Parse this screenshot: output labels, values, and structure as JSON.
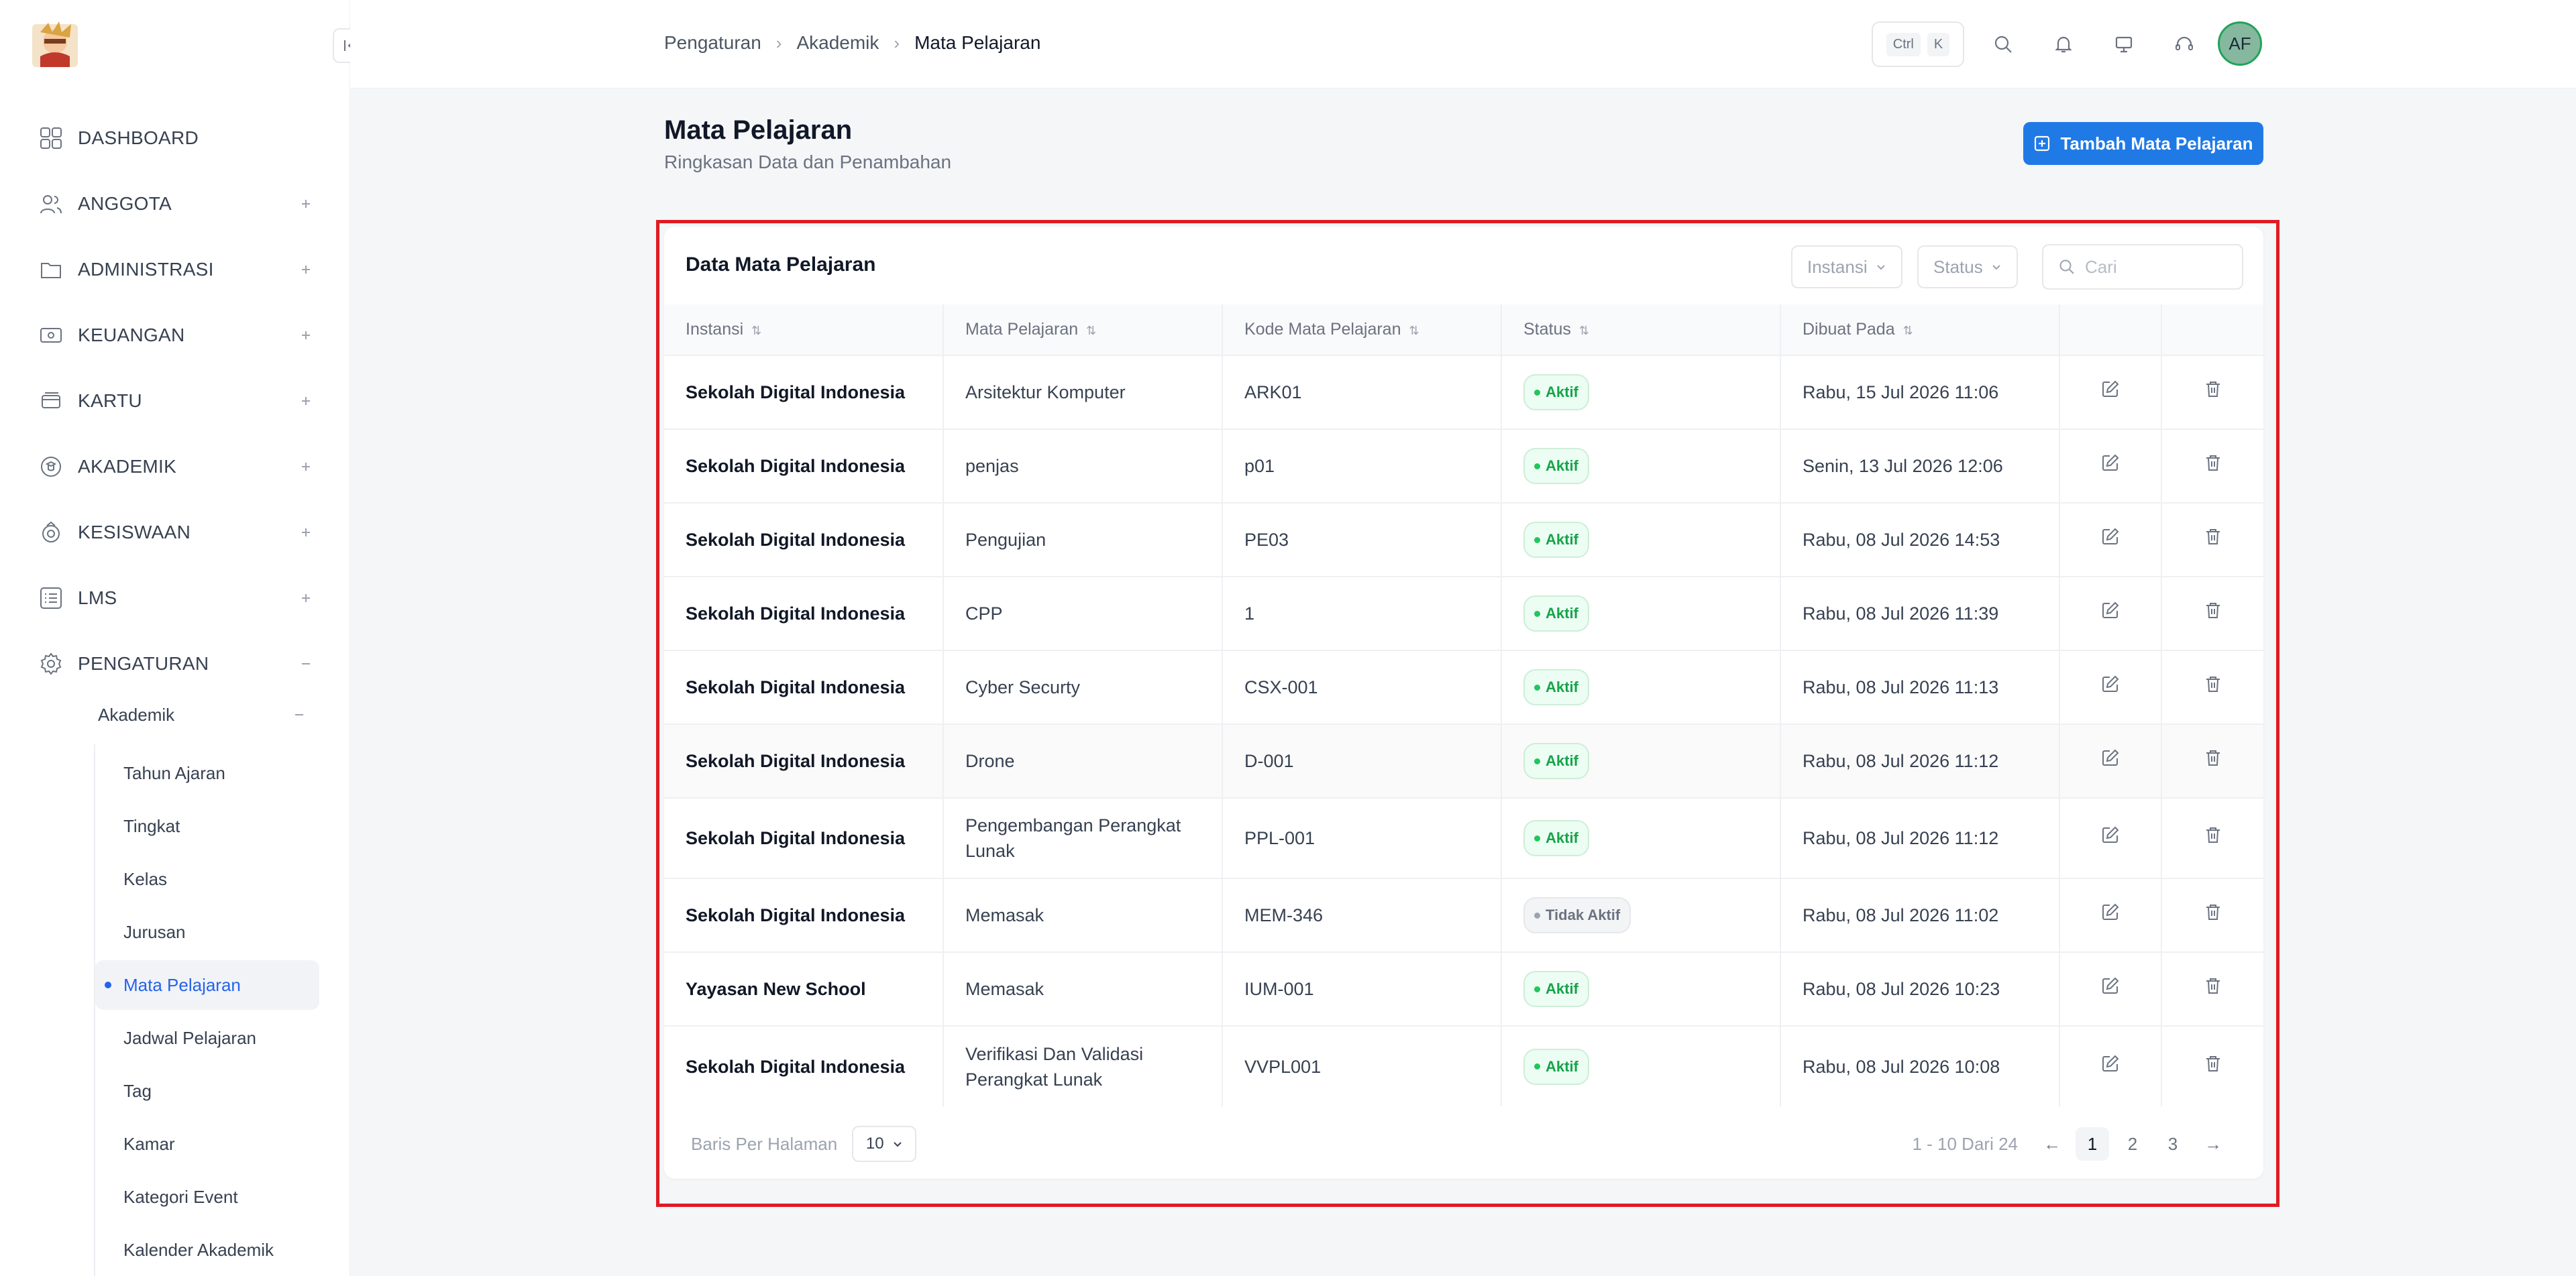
{
  "sidebar": {
    "items": [
      {
        "label": "DASHBOARD",
        "icon": "grid-icon",
        "toggle": ""
      },
      {
        "label": "ANGGOTA",
        "icon": "users-icon",
        "toggle": "+"
      },
      {
        "label": "ADMINISTRASI",
        "icon": "folder-icon",
        "toggle": "+"
      },
      {
        "label": "KEUANGAN",
        "icon": "money-icon",
        "toggle": "+"
      },
      {
        "label": "KARTU",
        "icon": "cards-icon",
        "toggle": "+"
      },
      {
        "label": "AKADEMIK",
        "icon": "academic-icon",
        "toggle": "+"
      },
      {
        "label": "KESISWAAN",
        "icon": "student-icon",
        "toggle": "+"
      },
      {
        "label": "LMS",
        "icon": "list-icon",
        "toggle": "+"
      },
      {
        "label": "PENGATURAN",
        "icon": "gear-icon",
        "toggle": "−"
      }
    ],
    "sub_group": {
      "label": "Akademik",
      "toggle": "−"
    },
    "leaves": [
      "Tahun Ajaran",
      "Tingkat",
      "Kelas",
      "Jurusan",
      "Mata Pelajaran",
      "Jadwal Pelajaran",
      "Tag",
      "Kamar",
      "Kategori Event",
      "Kalender Akademik"
    ],
    "active_leaf": "Mata Pelajaran"
  },
  "header": {
    "breadcrumb": [
      "Pengaturan",
      "Akademik",
      "Mata Pelajaran"
    ],
    "shortcut": {
      "key1": "Ctrl",
      "key2": "K"
    },
    "avatar_initials": "AF"
  },
  "page": {
    "title": "Mata Pelajaran",
    "subtitle": "Ringkasan Data dan Penambahan",
    "add_button": "Tambah Mata Pelajaran"
  },
  "card": {
    "title": "Data Mata Pelajaran",
    "filter_instansi": "Instansi",
    "filter_status": "Status",
    "search_placeholder": "Cari"
  },
  "table": {
    "columns": [
      "Instansi",
      "Mata Pelajaran",
      "Kode Mata Pelajaran",
      "Status",
      "Dibuat Pada"
    ],
    "rows": [
      {
        "instansi": "Sekolah Digital Indonesia",
        "mapel": "Arsitektur Komputer",
        "kode": "ARK01",
        "status": "Aktif",
        "dibuat": "Rabu, 15 Jul 2026 11:06"
      },
      {
        "instansi": "Sekolah Digital Indonesia",
        "mapel": "penjas",
        "kode": "p01",
        "status": "Aktif",
        "dibuat": "Senin, 13 Jul 2026 12:06"
      },
      {
        "instansi": "Sekolah Digital Indonesia",
        "mapel": "Pengujian",
        "kode": "PE03",
        "status": "Aktif",
        "dibuat": "Rabu, 08 Jul 2026 14:53"
      },
      {
        "instansi": "Sekolah Digital Indonesia",
        "mapel": "CPP",
        "kode": "1",
        "status": "Aktif",
        "dibuat": "Rabu, 08 Jul 2026 11:39"
      },
      {
        "instansi": "Sekolah Digital Indonesia",
        "mapel": "Cyber Securty",
        "kode": "CSX-001",
        "status": "Aktif",
        "dibuat": "Rabu, 08 Jul 2026 11:13"
      },
      {
        "instansi": "Sekolah Digital Indonesia",
        "mapel": "Drone",
        "kode": "D-001",
        "status": "Aktif",
        "dibuat": "Rabu, 08 Jul 2026 11:12"
      },
      {
        "instansi": "Sekolah Digital Indonesia",
        "mapel": "Pengembangan Perangkat Lunak",
        "kode": "PPL-001",
        "status": "Aktif",
        "dibuat": "Rabu, 08 Jul 2026 11:12"
      },
      {
        "instansi": "Sekolah Digital Indonesia",
        "mapel": "Memasak",
        "kode": "MEM-346",
        "status": "Tidak Aktif",
        "dibuat": "Rabu, 08 Jul 2026 11:02"
      },
      {
        "instansi": "Yayasan New School",
        "mapel": "Memasak",
        "kode": "IUM-001",
        "status": "Aktif",
        "dibuat": "Rabu, 08 Jul 2026 10:23"
      },
      {
        "instansi": "Sekolah Digital Indonesia",
        "mapel": "Verifikasi Dan Validasi Perangkat Lunak",
        "kode": "VVPL001",
        "status": "Aktif",
        "dibuat": "Rabu, 08 Jul 2026 10:08"
      }
    ]
  },
  "pagination": {
    "rows_label": "Baris Per Halaman",
    "rows_value": "10",
    "range": "1 - 10 Dari 24",
    "pages": [
      "1",
      "2",
      "3"
    ],
    "current": "1",
    "prev": "←",
    "next": "→"
  },
  "colors": {
    "accent": "#1f7ae6",
    "active_green": "#16a34a",
    "highlight_red": "#e01b24"
  }
}
